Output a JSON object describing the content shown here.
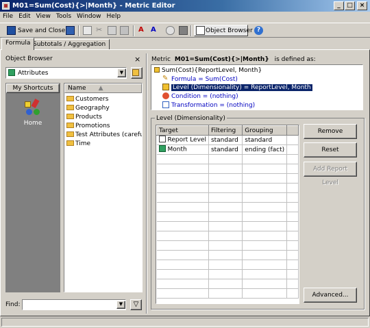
{
  "window": {
    "title": "M01=Sum(Cost){>|Month} - Metric Editor"
  },
  "menu": [
    "File",
    "Edit",
    "View",
    "Tools",
    "Window",
    "Help"
  ],
  "toolbar": {
    "save_close": "Save and Close",
    "object_browser": "Object Browser"
  },
  "tabs": [
    "Formula",
    "Subtotals / Aggregation"
  ],
  "object_browser": {
    "title": "Object Browser",
    "selected_folder": "Attributes",
    "shortcuts_header": "My Shortcuts",
    "home_label": "Home",
    "list_header": "Name",
    "items": [
      "Customers",
      "Geography",
      "Products",
      "Promotions",
      "Test Attributes (careful o",
      "Time"
    ],
    "find_label": "Find:"
  },
  "definition": {
    "prefix": "Metric",
    "metric_name": "M01=Sum(Cost){>|Month}",
    "suffix": "is defined as:",
    "root": "Sum(Cost){ReportLevel, Month}",
    "formula": "Formula = Sum(Cost)",
    "level": "Level (Dimensionality) = ReportLevel, Month",
    "condition": "Condition = (nothing)",
    "transformation": "Transformation = (nothing)"
  },
  "level_panel": {
    "group_label": "Level (Dimensionality)",
    "columns": [
      "Target",
      "Filtering",
      "Grouping"
    ],
    "rows": [
      {
        "target": "Report Level",
        "filtering": "standard",
        "grouping": "standard"
      },
      {
        "target": "Month",
        "filtering": "standard",
        "grouping": "ending (fact)"
      }
    ],
    "buttons": {
      "remove": "Remove",
      "reset": "Reset",
      "add_report_level": "Add Report Level",
      "advanced": "Advanced..."
    }
  },
  "colors": {
    "title_start": "#0a246a",
    "title_end": "#a6caf0",
    "selection": "#0a246a",
    "link_blue": "#0000c0"
  }
}
